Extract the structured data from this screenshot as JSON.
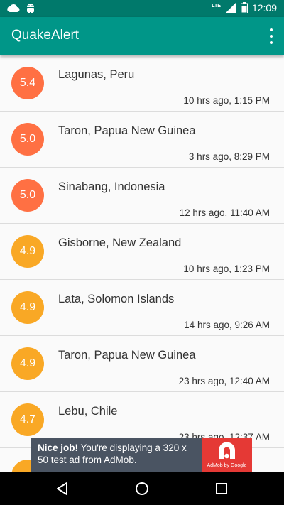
{
  "status_bar": {
    "time": "12:09",
    "network": "LTE",
    "icons": [
      "cloud-icon",
      "android-icon",
      "signal-icon",
      "battery-icon"
    ]
  },
  "app_bar": {
    "title": "QuakeAlert",
    "menu_icon": "overflow-menu-icon"
  },
  "quakes": [
    {
      "magnitude": "5.4",
      "location": "Lagunas, Peru",
      "time": "10 hrs ago, 1:15 PM",
      "color": "#ff7043"
    },
    {
      "magnitude": "5.0",
      "location": "Taron, Papua New Guinea",
      "time": "3 hrs ago, 8:29 PM",
      "color": "#ff7043"
    },
    {
      "magnitude": "5.0",
      "location": "Sinabang, Indonesia",
      "time": "12 hrs ago, 11:40 AM",
      "color": "#ff7043"
    },
    {
      "magnitude": "4.9",
      "location": "Gisborne, New Zealand",
      "time": "10 hrs ago, 1:23 PM",
      "color": "#f9a825"
    },
    {
      "magnitude": "4.9",
      "location": "Lata, Solomon Islands",
      "time": "14 hrs ago, 9:26 AM",
      "color": "#f9a825"
    },
    {
      "magnitude": "4.9",
      "location": "Taron, Papua New Guinea",
      "time": "23 hrs ago, 12:40 AM",
      "color": "#f9a825"
    },
    {
      "magnitude": "4.7",
      "location": "Lebu, Chile",
      "time": "23 hrs ago, 12:37 AM",
      "color": "#f9a825"
    },
    {
      "magnitude": "",
      "location": "",
      "time": "",
      "color": "#f9a825"
    }
  ],
  "ad": {
    "headline": "Nice job!",
    "body": " You're displaying a 320 x 50 test ad from AdMob.",
    "logo_caption": "AdMob by Google"
  },
  "nav_bar": {
    "buttons": [
      "back-icon",
      "home-icon",
      "recents-icon"
    ]
  }
}
